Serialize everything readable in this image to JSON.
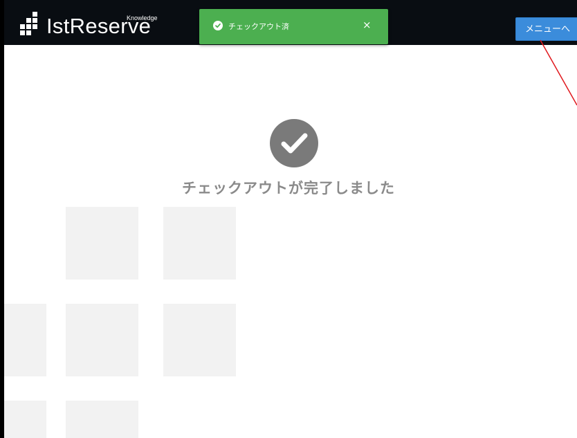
{
  "header": {
    "logo_text": "IstReserve",
    "logo_sub": "Knowledge",
    "menu_button_label": "メニューへ"
  },
  "toast": {
    "message": "チェックアウト済",
    "close_label": "×",
    "icon": "check-circle-icon",
    "color": "#4caf50"
  },
  "main": {
    "status_icon": "check-circle-icon",
    "status_message": "チェックアウトが完了しました"
  },
  "colors": {
    "header_bg": "#090d12",
    "accent": "#3b8cdb",
    "annotation": "#e0171c"
  }
}
